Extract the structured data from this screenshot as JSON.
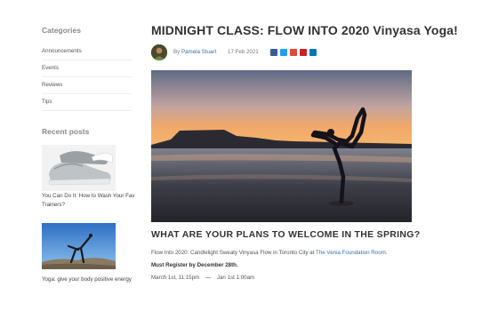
{
  "sidebar": {
    "categories_title": "Categories",
    "categories": [
      "Announcements",
      "Events",
      "Reviews",
      "Tips"
    ],
    "recent_title": "Recent posts",
    "recent_posts": [
      {
        "title": "You Can Do It: How to Wash Your Fav Trainers?"
      },
      {
        "title": "Yoga: give your body positive energy"
      }
    ]
  },
  "post": {
    "title": "MIDNIGHT CLASS: FLOW INTO 2020 Vinyasa Yoga!",
    "by_label": "By",
    "author": "Pamela Stuart",
    "date": "17 Feb 2021",
    "share_icons": [
      "facebook-icon",
      "twitter-icon",
      "google-plus-icon",
      "pinterest-icon",
      "linkedin-icon"
    ],
    "share_colors": [
      "#3b5998",
      "#1da1f2",
      "#dd4b39",
      "#cb2027",
      "#0077b5"
    ],
    "section_heading": "WHAT ARE YOUR PLANS TO WELCOME IN THE SPRING?",
    "intro_text": "Flow Into 2020: Candlelight Sweaty Vinyasa Flow in Toronto City at",
    "venue": "The Venia Foundation Room.",
    "register_note": "Must Register by December 28th.",
    "start": "March 1st, 11:15pm",
    "dash": "—",
    "end": "Jan 1st 1:00am"
  }
}
